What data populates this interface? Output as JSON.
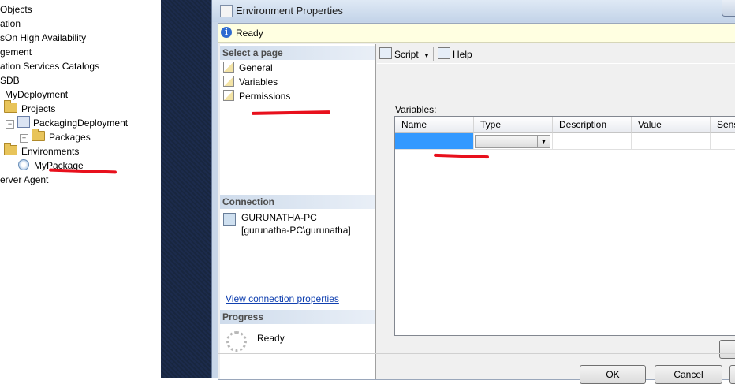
{
  "tree": {
    "items": [
      {
        "label": "Objects"
      },
      {
        "label": "ation"
      },
      {
        "label": "sOn High Availability"
      },
      {
        "label": "gement"
      },
      {
        "label": "ation Services Catalogs"
      },
      {
        "label": "SDB"
      },
      {
        "label": "MyDeployment"
      },
      {
        "label": "Projects"
      },
      {
        "label": "PackagingDeployment"
      },
      {
        "label": "Packages"
      },
      {
        "label": "Environments"
      },
      {
        "label": "MyPackage"
      },
      {
        "label": "erver Agent"
      }
    ]
  },
  "dialog": {
    "title": "Environment Properties",
    "status": "Ready",
    "select_page_header": "Select a page",
    "pages": [
      {
        "label": "General",
        "icon": "page-icon"
      },
      {
        "label": "Variables",
        "icon": "page-icon"
      },
      {
        "label": "Permissions",
        "icon": "page-icon"
      }
    ],
    "connection_header": "Connection",
    "connection_server": "GURUNATHA-PC",
    "connection_user": "[gurunatha-PC\\gurunatha]",
    "connection_link": "View connection properties",
    "progress_header": "Progress",
    "progress_status": "Ready",
    "toolbar": {
      "script": "Script",
      "help": "Help"
    },
    "variables_label": "Variables:",
    "columns": [
      "Name",
      "Type",
      "Description",
      "Value",
      "Sensi"
    ],
    "buttons": {
      "ok": "OK",
      "cancel": "Cancel"
    }
  },
  "annotations": {
    "color": "#e8101c"
  }
}
